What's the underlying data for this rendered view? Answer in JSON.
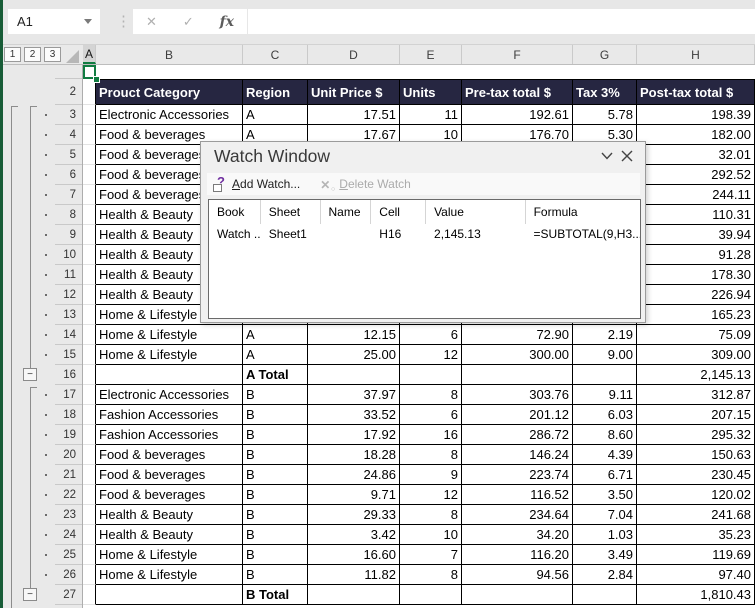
{
  "name_box": {
    "value": "A1"
  },
  "formula_bar": {
    "cancel_icon": "✕",
    "enter_icon": "✓",
    "fx_label": "fx",
    "value": ""
  },
  "outline": {
    "level_buttons": [
      "1",
      "2",
      "3"
    ],
    "collapse_glyph": "−"
  },
  "columns": [
    "A",
    "B",
    "C",
    "D",
    "E",
    "F",
    "G",
    "H"
  ],
  "table": {
    "header_row_number": 2,
    "headers": [
      "Prouct Category",
      "Region",
      "Unit Price $",
      "Units",
      "Pre-tax total $",
      "Tax 3%",
      "Post-tax total $"
    ],
    "rows": [
      {
        "row": 3,
        "cells": [
          "Electronic Accessories",
          "A",
          "17.51",
          "11",
          "192.61",
          "5.78",
          "198.39"
        ],
        "total": false
      },
      {
        "row": 4,
        "cells": [
          "Food & beverages",
          "A",
          "17.67",
          "10",
          "176.70",
          "5.30",
          "182.00"
        ],
        "total": false
      },
      {
        "row": 5,
        "cells": [
          "Food & beverages",
          "",
          "",
          "",
          "",
          "",
          "32.01"
        ],
        "total": false
      },
      {
        "row": 6,
        "cells": [
          "Food & beverages",
          "",
          "",
          "",
          "",
          "",
          "292.52"
        ],
        "total": false
      },
      {
        "row": 7,
        "cells": [
          "Food & beverages",
          "",
          "",
          "",
          "",
          "",
          "244.11"
        ],
        "total": false
      },
      {
        "row": 8,
        "cells": [
          "Health & Beauty",
          "",
          "",
          "",
          "",
          "",
          "110.31"
        ],
        "total": false
      },
      {
        "row": 9,
        "cells": [
          "Health & Beauty",
          "",
          "",
          "",
          "",
          "",
          "39.94"
        ],
        "total": false
      },
      {
        "row": 10,
        "cells": [
          "Health & Beauty",
          "",
          "",
          "",
          "",
          "",
          "91.28"
        ],
        "total": false
      },
      {
        "row": 11,
        "cells": [
          "Health & Beauty",
          "",
          "",
          "",
          "",
          "",
          "178.30"
        ],
        "total": false
      },
      {
        "row": 12,
        "cells": [
          "Health & Beauty",
          "",
          "",
          "",
          "",
          "",
          "226.94"
        ],
        "total": false
      },
      {
        "row": 13,
        "cells": [
          "Home & Lifestyle",
          "",
          "",
          "",
          "",
          "",
          "165.23"
        ],
        "total": false
      },
      {
        "row": 14,
        "cells": [
          "Home & Lifestyle",
          "A",
          "12.15",
          "6",
          "72.90",
          "2.19",
          "75.09"
        ],
        "total": false
      },
      {
        "row": 15,
        "cells": [
          "Home & Lifestyle",
          "A",
          "25.00",
          "12",
          "300.00",
          "9.00",
          "309.00"
        ],
        "total": false
      },
      {
        "row": 16,
        "cells": [
          "",
          "A Total",
          "",
          "",
          "",
          "",
          "2,145.13"
        ],
        "total": true
      },
      {
        "row": 17,
        "cells": [
          "Electronic Accessories",
          "B",
          "37.97",
          "8",
          "303.76",
          "9.11",
          "312.87"
        ],
        "total": false
      },
      {
        "row": 18,
        "cells": [
          "Fashion Accessories",
          "B",
          "33.52",
          "6",
          "201.12",
          "6.03",
          "207.15"
        ],
        "total": false
      },
      {
        "row": 19,
        "cells": [
          "Fashion Accessories",
          "B",
          "17.92",
          "16",
          "286.72",
          "8.60",
          "295.32"
        ],
        "total": false
      },
      {
        "row": 20,
        "cells": [
          "Food & beverages",
          "B",
          "18.28",
          "8",
          "146.24",
          "4.39",
          "150.63"
        ],
        "total": false
      },
      {
        "row": 21,
        "cells": [
          "Food & beverages",
          "B",
          "24.86",
          "9",
          "223.74",
          "6.71",
          "230.45"
        ],
        "total": false
      },
      {
        "row": 22,
        "cells": [
          "Food & beverages",
          "B",
          "9.71",
          "12",
          "116.52",
          "3.50",
          "120.02"
        ],
        "total": false
      },
      {
        "row": 23,
        "cells": [
          "Health & Beauty",
          "B",
          "29.33",
          "8",
          "234.64",
          "7.04",
          "241.68"
        ],
        "total": false
      },
      {
        "row": 24,
        "cells": [
          "Health & Beauty",
          "B",
          "3.42",
          "10",
          "34.20",
          "1.03",
          "35.23"
        ],
        "total": false
      },
      {
        "row": 25,
        "cells": [
          "Home & Lifestyle",
          "B",
          "16.60",
          "7",
          "116.20",
          "3.49",
          "119.69"
        ],
        "total": false
      },
      {
        "row": 26,
        "cells": [
          "Home & Lifestyle",
          "B",
          "11.82",
          "8",
          "94.56",
          "2.84",
          "97.40"
        ],
        "total": false
      },
      {
        "row": 27,
        "cells": [
          "",
          "B Total",
          "",
          "",
          "",
          "",
          "1,810.43"
        ],
        "total": true
      }
    ]
  },
  "watch_window": {
    "title": "Watch Window",
    "add_watch": {
      "accel": "A",
      "rest": "dd Watch..."
    },
    "delete_watch": {
      "accel": "D",
      "rest": "elete Watch"
    },
    "columns": [
      "Book",
      "Sheet",
      "Name",
      "Cell",
      "Value",
      "Formula"
    ],
    "watches": [
      [
        "Watch ...",
        "Sheet1",
        "",
        "H16",
        "2,145.13",
        "=SUBTOTAL(9,H3..."
      ]
    ]
  },
  "colors": {
    "table_header_bg": "#262641",
    "selection_green": "#107C41",
    "window_edge_green": "#185C37",
    "add_icon_purple": "#7030A0"
  }
}
